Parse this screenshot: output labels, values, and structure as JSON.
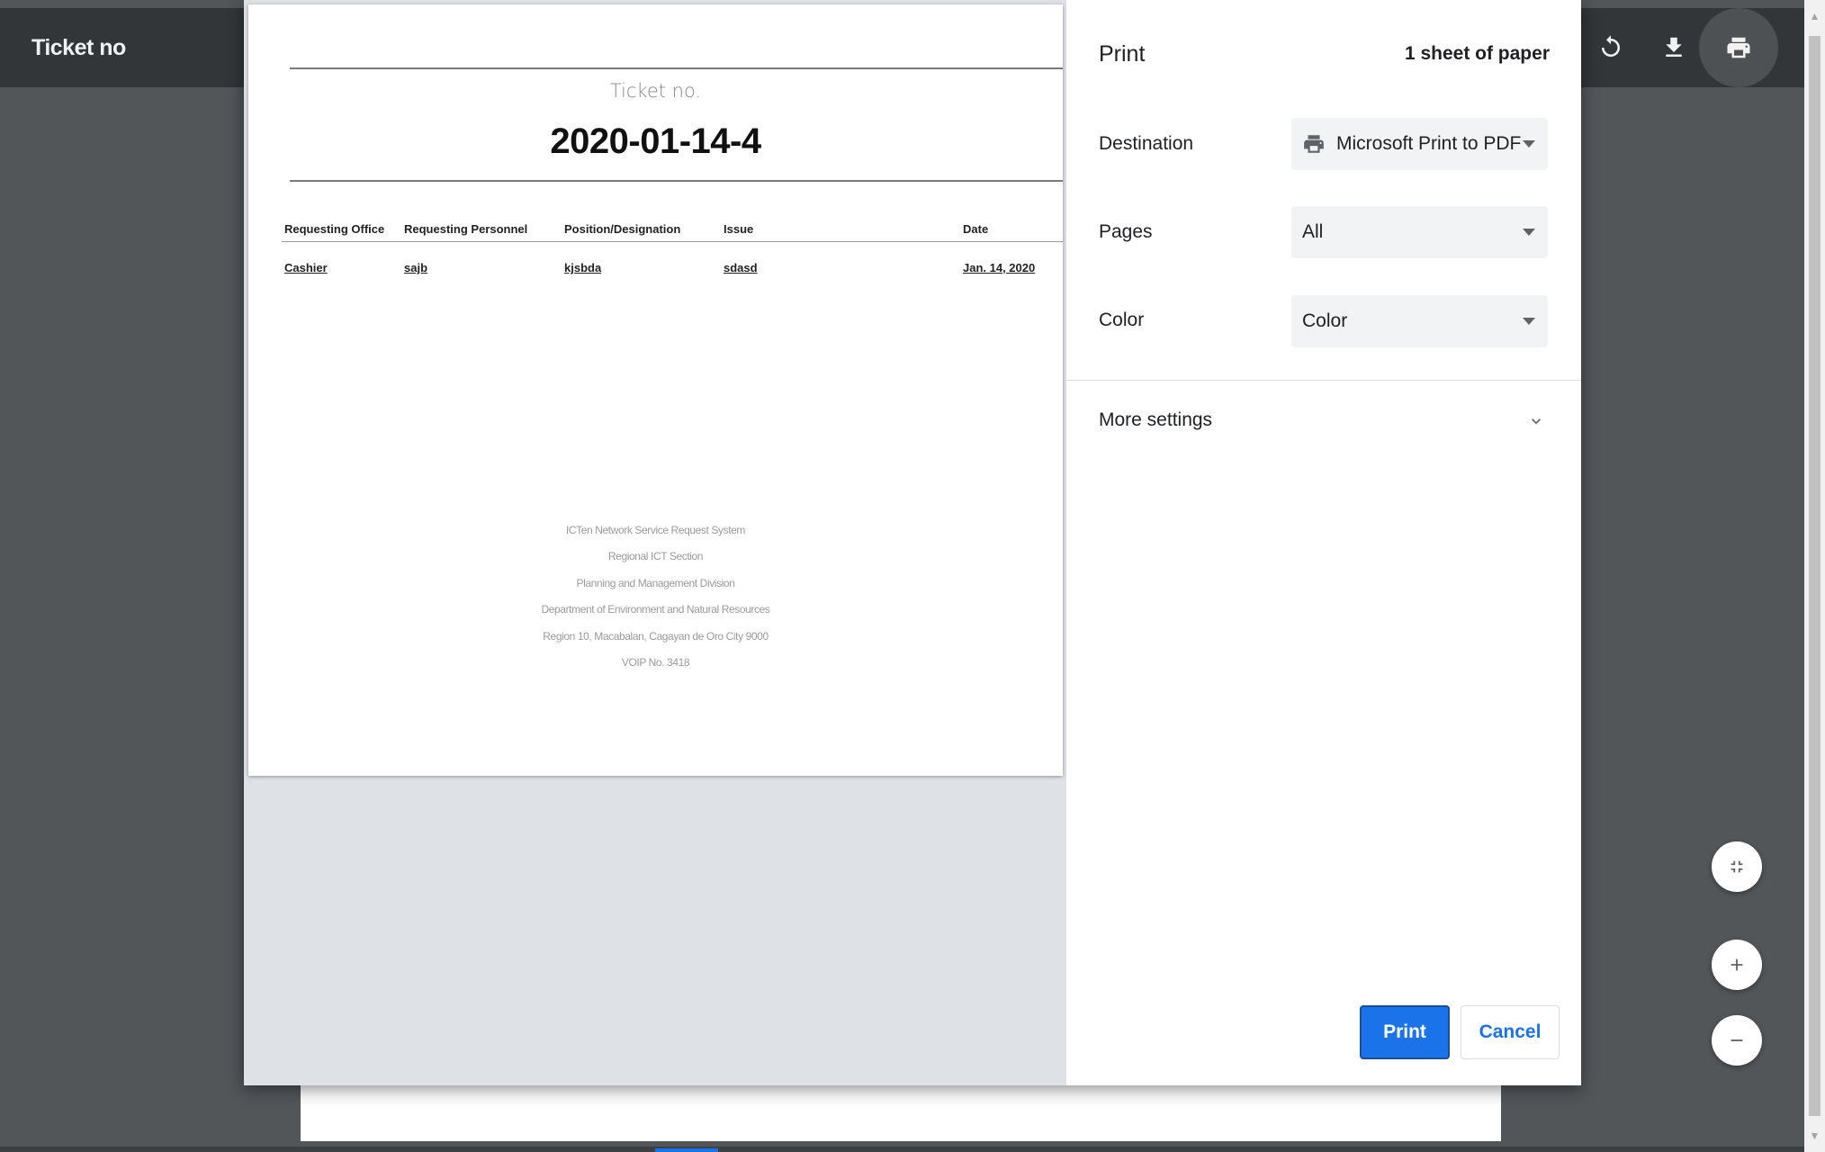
{
  "viewer": {
    "title": "Ticket no",
    "icons": [
      "rotate-icon",
      "download-icon",
      "print-icon"
    ]
  },
  "preview": {
    "ticket_label": "Ticket no.",
    "ticket_number": "2020-01-14-4",
    "table": {
      "headers": [
        "Requesting Office",
        "Requesting Personnel",
        "Position/Designation",
        "Issue",
        "Date"
      ],
      "row": [
        "Cashier",
        "sajb",
        "kjsbda",
        "sdasd",
        "Jan. 14, 2020"
      ]
    },
    "footer": [
      "ICTen Network Service Request System",
      "Regional ICT Section",
      "Planning and Management Division",
      "Department of Environment and Natural Resources",
      "Region 10, Macabalan, Cagayan de Oro City 9000",
      "VOIP No. 3418"
    ]
  },
  "print": {
    "title": "Print",
    "sheets": "1 sheet of paper",
    "destination_label": "Destination",
    "destination_value": "Microsoft Print to PDF",
    "pages_label": "Pages",
    "pages_value": "All",
    "color_label": "Color",
    "color_value": "Color",
    "more_settings": "More settings",
    "print_button": "Print",
    "cancel_button": "Cancel"
  },
  "colors": {
    "accent": "#1a73e8",
    "toolbar": "#323639",
    "backdrop": "#525659"
  }
}
